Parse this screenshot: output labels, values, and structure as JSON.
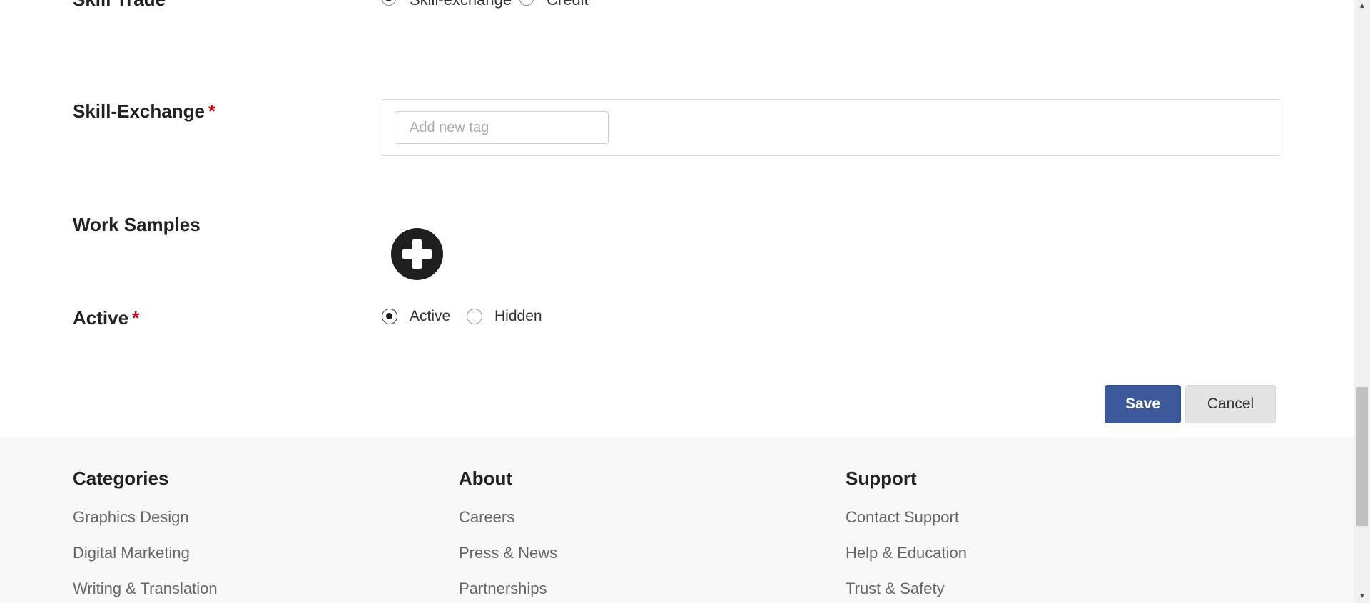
{
  "form": {
    "skill_trade": {
      "label": "Skill Trade",
      "options": [
        "Skill-exchange",
        "Credit"
      ],
      "selected": "Skill-exchange"
    },
    "skill_exchange": {
      "label": "Skill-Exchange",
      "required_mark": "*",
      "placeholder": "Add new tag"
    },
    "work_samples": {
      "label": "Work Samples",
      "add_icon": "plus-circle-icon"
    },
    "active": {
      "label": "Active",
      "required_mark": "*",
      "options": [
        "Active",
        "Hidden"
      ],
      "selected": "Active"
    },
    "actions": {
      "save_label": "Save",
      "cancel_label": "Cancel",
      "save_color": "#3b5998"
    }
  },
  "footer": {
    "columns": [
      {
        "heading": "Categories",
        "links": [
          "Graphics Design",
          "Digital Marketing",
          "Writing & Translation"
        ]
      },
      {
        "heading": "About",
        "links": [
          "Careers",
          "Press & News",
          "Partnerships"
        ]
      },
      {
        "heading": "Support",
        "links": [
          "Contact Support",
          "Help & Education",
          "Trust & Safety"
        ]
      }
    ]
  }
}
